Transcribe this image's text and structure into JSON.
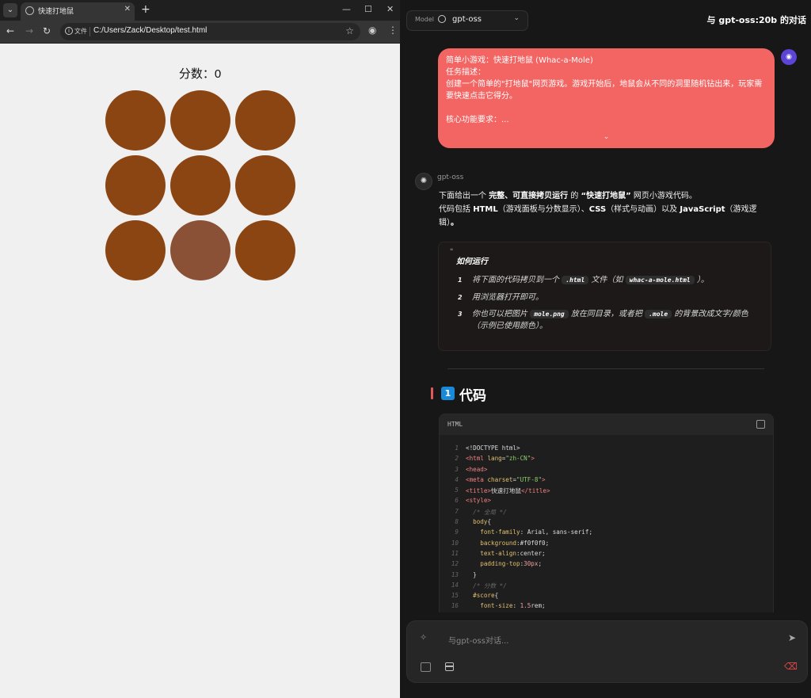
{
  "browser": {
    "tab_title": "快速打地鼠",
    "url": "C:/Users/Zack/Desktop/test.html",
    "url_chip": "文件",
    "page": {
      "score_text": "分数：0",
      "holes": [
        {
          "active": false
        },
        {
          "active": false
        },
        {
          "active": false
        },
        {
          "active": false
        },
        {
          "active": false
        },
        {
          "active": false
        },
        {
          "active": false
        },
        {
          "active": true
        },
        {
          "active": false
        }
      ],
      "hole_color": "#8b4513",
      "active_hole_color": "#8b5136"
    }
  },
  "chat": {
    "model_label": "Model",
    "model_name": "gpt-oss",
    "conversation_title": "与 gpt-oss:20b 的对话",
    "user_message": "简单小游戏：快速打地鼠 (Whac-a-Mole)\n任务描述：\n创建一个简单的\"打地鼠\"网页游戏。游戏开始后，地鼠会从不同的洞里随机钻出来，玩家需要快速点击它得分。\n\n核心功能要求：...",
    "bot_name": "gpt-oss",
    "intro_1_pre": "下面给出一个 ",
    "intro_1_bold1": "完整、可直接拷贝运行",
    "intro_1_mid": " 的 ",
    "intro_1_bold2": "“快速打地鼠”",
    "intro_1_post": " 网页小游戏代码。",
    "intro_2_pre": "代码包括 ",
    "intro_2_b1": "HTML",
    "intro_2_m1": "（游戏面板与分数显示）、",
    "intro_2_b2": "CSS",
    "intro_2_m2": "（样式与动画）以及 ",
    "intro_2_b3": "JavaScript",
    "intro_2_m3": "（游戏逻辑）",
    "intro_2_end": "。",
    "howto": {
      "title": "如何运行",
      "steps": [
        {
          "n": "1",
          "pre": "将下面的代码拷贝到一个 ",
          "c1": ".html",
          "mid": " 文件（如 ",
          "c2": "whac-a-mole.html",
          "post": " ）。"
        },
        {
          "n": "2",
          "text": "用浏览器打开即可。"
        },
        {
          "n": "3",
          "pre": "你也可以把图片 ",
          "c1": "mole.png",
          "mid": " 放在同目录，或者把 ",
          "c2": ".mole",
          "post": " 的背景改成文字/颜色（示例已使用颜色）。"
        }
      ]
    },
    "section_num": "1",
    "section_title": "代码",
    "code_lang": "HTML",
    "code_lines": [
      {
        "n": "1",
        "parts": [
          [
            "txt2",
            "<!DOCTYPE html>"
          ]
        ]
      },
      {
        "n": "2",
        "parts": [
          [
            "tag",
            "<html "
          ],
          [
            "attr",
            "lang"
          ],
          [
            "txt2",
            "="
          ],
          [
            "str",
            "\"zh-CN\""
          ],
          [
            "tag",
            ">"
          ]
        ]
      },
      {
        "n": "3",
        "parts": [
          [
            "tag",
            "<head>"
          ]
        ]
      },
      {
        "n": "4",
        "parts": [
          [
            "tag",
            "<meta "
          ],
          [
            "attr",
            "charset"
          ],
          [
            "txt2",
            "="
          ],
          [
            "str",
            "\"UTF-8\""
          ],
          [
            "tag",
            ">"
          ]
        ]
      },
      {
        "n": "5",
        "parts": [
          [
            "tag",
            "<title>"
          ],
          [
            "txt2",
            "快速打地鼠"
          ],
          [
            "tag",
            "</title>"
          ]
        ]
      },
      {
        "n": "6",
        "parts": [
          [
            "tag",
            "<style>"
          ]
        ]
      },
      {
        "n": "7",
        "parts": [
          [
            "cmt",
            "  /* 全局 */"
          ]
        ]
      },
      {
        "n": "8",
        "parts": [
          [
            "sel",
            "  body"
          ],
          [
            "txt2",
            "{"
          ]
        ]
      },
      {
        "n": "9",
        "parts": [
          [
            "prop",
            "    font-family"
          ],
          [
            "txt2",
            ": Arial, sans-serif;"
          ]
        ]
      },
      {
        "n": "10",
        "parts": [
          [
            "prop",
            "    background"
          ],
          [
            "txt2",
            ":#f0f0f0;"
          ]
        ]
      },
      {
        "n": "11",
        "parts": [
          [
            "prop",
            "    text-align"
          ],
          [
            "txt2",
            ":center;"
          ]
        ]
      },
      {
        "n": "12",
        "parts": [
          [
            "prop",
            "    padding-top"
          ],
          [
            "txt2",
            ":"
          ],
          [
            "val",
            "30px"
          ],
          [
            "txt2",
            ";"
          ]
        ]
      },
      {
        "n": "13",
        "parts": [
          [
            "txt2",
            "  }"
          ]
        ]
      },
      {
        "n": "14",
        "parts": [
          [
            "cmt",
            "  /* 分数 */"
          ]
        ]
      },
      {
        "n": "15",
        "parts": [
          [
            "sel",
            "  #score"
          ],
          [
            "txt2",
            "{"
          ]
        ]
      },
      {
        "n": "16",
        "parts": [
          [
            "prop",
            "    font-size"
          ],
          [
            "txt2",
            ": "
          ],
          [
            "val",
            "1.5"
          ],
          [
            "txt2",
            "rem;"
          ]
        ]
      }
    ],
    "input_placeholder": "与gpt-oss对话..."
  }
}
